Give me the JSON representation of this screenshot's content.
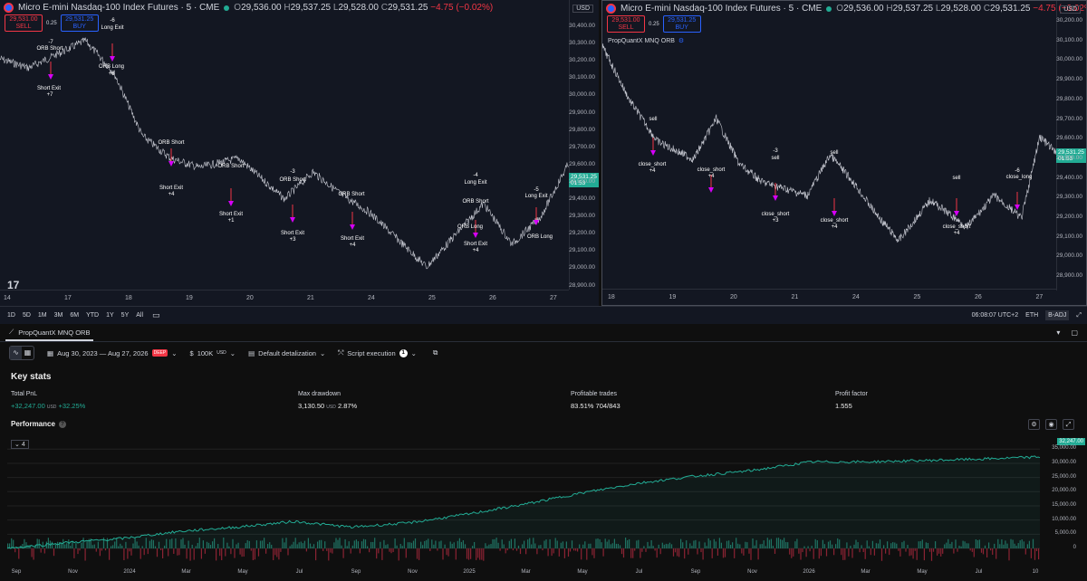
{
  "left_chart": {
    "symbol_title": "Micro E-mini Nasdaq-100 Index Futures · 5 · CME",
    "ohlc": {
      "o": "29,536.00",
      "h": "29,537.25",
      "l": "29,528.00",
      "c": "29,531.25",
      "chg": "−4.75 (−0.02%)"
    },
    "sell_price": "29,531.00",
    "sell_label": "SELL",
    "buy_price": "29,531.25",
    "buy_label": "BUY",
    "spread": "0.25",
    "currency": "USD",
    "last_price": "29,531.25",
    "countdown": "01:53",
    "price_ticks": [
      "30,400.00",
      "30,300.00",
      "30,200.00",
      "30,100.00",
      "30,000.00",
      "29,900.00",
      "29,800.00",
      "29,700.00",
      "29,600.00",
      "29,500.00",
      "29,400.00",
      "29,300.00",
      "29,200.00",
      "29,100.00",
      "29,000.00",
      "28,900.00"
    ],
    "time_ticks": [
      "14",
      "17",
      "18",
      "19",
      "20",
      "21",
      "24",
      "25",
      "26",
      "27"
    ],
    "signals": [
      {
        "text": "-7"
      },
      {
        "text": "ORB Short"
      },
      {
        "text": "Short Exit"
      },
      {
        "text": "+7"
      },
      {
        "text": "-6"
      },
      {
        "text": "Long Exit"
      },
      {
        "text": "ORB Long"
      },
      {
        "text": "+6"
      },
      {
        "text": "ORB Short"
      },
      {
        "text": "Short Exit"
      },
      {
        "text": "+4"
      },
      {
        "text": "ORB Short"
      },
      {
        "text": "Short Exit"
      },
      {
        "text": "+1"
      },
      {
        "text": "-3"
      },
      {
        "text": "ORB Short"
      },
      {
        "text": "Short Exit"
      },
      {
        "text": "+3"
      },
      {
        "text": "ORB Short"
      },
      {
        "text": "Short Exit"
      },
      {
        "text": "+4"
      },
      {
        "text": "-4"
      },
      {
        "text": "Long Exit"
      },
      {
        "text": "ORB Short"
      },
      {
        "text": "ORB Long"
      },
      {
        "text": "Short Exit"
      },
      {
        "text": "+4"
      },
      {
        "text": "-5"
      },
      {
        "text": "Long Exit"
      },
      {
        "text": "ORB Long"
      }
    ]
  },
  "right_chart": {
    "symbol_title": "Micro E-mini Nasdaq-100 Index Futures · 5 · CME",
    "ohlc": {
      "o": "29,536.00",
      "h": "29,537.25",
      "l": "29,528.00",
      "c": "29,531.25",
      "chg": "−4.75 (−0.02%)"
    },
    "sell_price": "29,531.00",
    "sell_label": "SELL",
    "buy_price": "29,531.25",
    "buy_label": "BUY",
    "spread": "0.25",
    "currency": "USD",
    "indicator": "PropQuantX MNQ ORB",
    "last_price": "29,531.25",
    "countdown": "01:53",
    "price_ticks": [
      "30,200.00",
      "30,100.00",
      "30,000.00",
      "29,900.00",
      "29,800.00",
      "29,700.00",
      "29,600.00",
      "29,500.00",
      "29,400.00",
      "29,300.00",
      "29,200.00",
      "29,100.00",
      "29,000.00",
      "28,900.00"
    ],
    "time_ticks": [
      "18",
      "19",
      "20",
      "21",
      "24",
      "25",
      "26",
      "27"
    ],
    "signals": [
      {
        "text": "sell"
      },
      {
        "text": "close_short"
      },
      {
        "text": "+4"
      },
      {
        "text": "close_short"
      },
      {
        "text": "+4"
      },
      {
        "text": "-3"
      },
      {
        "text": "sell"
      },
      {
        "text": "close_short"
      },
      {
        "text": "+3"
      },
      {
        "text": "sell"
      },
      {
        "text": "close_short"
      },
      {
        "text": "+4"
      },
      {
        "text": "sell"
      },
      {
        "text": "close_short"
      },
      {
        "text": "+4"
      },
      {
        "text": "-6"
      },
      {
        "text": "close_long"
      }
    ]
  },
  "range_bar": {
    "ranges": [
      "1D",
      "5D",
      "1M",
      "3M",
      "6M",
      "YTD",
      "1Y",
      "5Y",
      "All"
    ],
    "clock": "06:08:07 UTC+2",
    "session": "ETH",
    "adjust": "B-ADJ"
  },
  "strategy": {
    "tab_name": "PropQuantX MNQ ORB",
    "date_range": "Aug 30, 2023 — Aug 27, 2026",
    "deep_badge": "DEEP",
    "capital": "100K",
    "capital_unit": "USD",
    "detail": "Default detalization",
    "execution": "Script execution",
    "execution_count": "1"
  },
  "key_stats": {
    "title": "Key stats",
    "total_pnl_label": "Total PnL",
    "total_pnl_value": "+32,247.00",
    "total_pnl_unit": "USD",
    "total_pnl_pct": "+32.25%",
    "max_dd_label": "Max drawdown",
    "max_dd_value": "3,130.50",
    "max_dd_unit": "USD",
    "max_dd_pct": "2.87%",
    "profitable_label": "Profitable trades",
    "profitable_pct": "83.51%",
    "profitable_ratio": "704/843",
    "pf_label": "Profit factor",
    "pf_value": "1.555"
  },
  "performance": {
    "title": "Performance",
    "chip": "4",
    "last_value_tag": "32,247.00",
    "y_ticks": [
      "35,000.00",
      "30,000.00",
      "25,000.00",
      "20,000.00",
      "15,000.00",
      "10,000.00",
      "5,000.00",
      "0"
    ],
    "x_ticks": [
      "Sep",
      "Nov",
      "2024",
      "Mar",
      "May",
      "Jul",
      "Sep",
      "Nov",
      "2025",
      "Mar",
      "May",
      "Jul",
      "Sep",
      "Nov",
      "2026",
      "Mar",
      "May",
      "Jul",
      "10"
    ]
  },
  "chart_data": {
    "type": "area",
    "title": "Performance",
    "x": [
      "Sep 2023",
      "Nov 2023",
      "Jan 2024",
      "Mar 2024",
      "May 2024",
      "Jul 2024",
      "Sep 2024",
      "Nov 2024",
      "Jan 2025",
      "Mar 2025",
      "May 2025",
      "Jul 2025",
      "Sep 2025",
      "Nov 2025",
      "Jan 2026",
      "Mar 2026",
      "May 2026",
      "Jul 2026",
      "Aug 2026"
    ],
    "series": [
      {
        "values": [
          0,
          2000,
          3500,
          6000,
          7500,
          9500,
          7500,
          9000,
          12000,
          15500,
          19500,
          23000,
          25500,
          27500,
          30500,
          30500,
          31000,
          31500,
          32247
        ]
      }
    ],
    "ylim": [
      0,
      37000
    ]
  },
  "colors": {
    "accent": "#22ab94",
    "sell": "#f23645",
    "buy": "#2962ff",
    "magenta": "#d500f9"
  }
}
